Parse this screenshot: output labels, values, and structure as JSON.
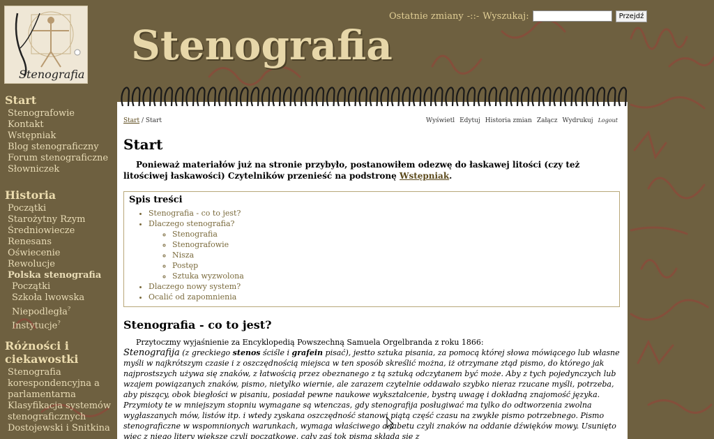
{
  "site": {
    "title": "Stenografia",
    "logo_text": "Stenografia"
  },
  "topbar": {
    "recent_changes": "Ostatnie zmiany",
    "separator": "-::-",
    "search_label": "Wyszukaj:",
    "search_value": "",
    "search_button": "Przejdź"
  },
  "sidebar": {
    "start": {
      "heading": "Start",
      "items": [
        "Stenografowie",
        "Kontakt",
        "Wstępniak",
        "Blog stenograficzny",
        "Forum stenograficzne",
        "Słowniczek"
      ]
    },
    "historia": {
      "heading": "Historia",
      "items": [
        "Początki",
        "Starożytny Rzym",
        "Średniowiecze",
        "Renesans",
        "Oświecenie",
        "Rewolucje"
      ],
      "current": "Polska stenografia",
      "subitems": [
        "Początki",
        "Szkoła lwowska",
        "Niepodległa",
        "Instytucje"
      ],
      "sup_mark": "?"
    },
    "roznosci": {
      "heading": "Różności i ciekawostki",
      "items": [
        "Stenografia korespondencyjna a parlamentarna",
        "Klasyfikacja systemów stenograficznych",
        "Dostojewski i Snitkina"
      ]
    }
  },
  "breadcrumb": {
    "home": "Start",
    "separator": "/",
    "current": "Start"
  },
  "actions": [
    "Wyświetl",
    "Edytuj",
    "Historia zmian",
    "Załącz",
    "Wydrukuj"
  ],
  "logout": "Logout",
  "page": {
    "title": "Start",
    "intro_text": "Ponieważ materiałów już na stronie przybyło, postanowiłem odezwę do łaskawej litości (czy też litościwej łaskawości) Czytelników przenieść na podstronę",
    "intro_link": "Wstępniak",
    "intro_end": "."
  },
  "toc": {
    "heading": "Spis treści",
    "item1": "Stenografia - co to jest?",
    "item2": "Dlaczego stenografia?",
    "subitems": [
      "Stenografia",
      "Stenografowie",
      "Nisza",
      "Postęp",
      "Sztuka wyzwolona"
    ],
    "item3": "Dlaczego nowy system?",
    "item4": "Ocalić od zapomnienia"
  },
  "section": {
    "heading": "Stenografia - co to jest?",
    "lead": "Przytoczmy wyjaśnienie za Encyklopedią Powszechną Samuela Orgelbranda z roku 1866:",
    "q_word": "Stenografija",
    "q1": " (z greckiego ",
    "q_stenos": "stenos",
    "q2": " ściśle i ",
    "q_grafein": "grafein",
    "q3": " pisać), jestto sztuka pisania, za pomocą której słowa mówiącego lub własne myśli w najkrótszym czasie i z oszczędnością miejsca w ten sposób skreślić można, iż otrzymane ztąd pismo, do którego jak najprostszych używa się znaków, z łatwością przez obeznanego z tą sztuką odczytanem być może. Aby z tych pojedynczych lub wzajem powiązanych znaków, pismo, nietylko wiernie, ale zarazem czytelnie oddawało szybko nieraz rzucane myśli, potrzeba, aby piszący, obok biegłości w pisaniu, posiadał pewne naukowe wykształcenie, bystrą uwagę i dokładną znajomość języka. Przymioty te w mniejszym stopniu wymagane są wtenczas, gdy stenografija posługiwać ma tylko do odtworzenia zwolna wygłaszanych mów, listów itp. i wtedy zyskana oszczędność stanowi piątą część czasu na zwykłe pismo potrzebnego. Pismo stenograficzne w wspomnionych warunkach, wymaga właściwego alfabetu czyli znaków na oddanie dźwięków mowy. Usunięto więc z niego litery większe czyli początkowe, cały zaś tok pisma składa się z"
  },
  "colors": {
    "background": "#6e6040",
    "sidebar_text": "#e9dcb6",
    "title": "#e7d7a9",
    "link": "#7a6a3c"
  }
}
